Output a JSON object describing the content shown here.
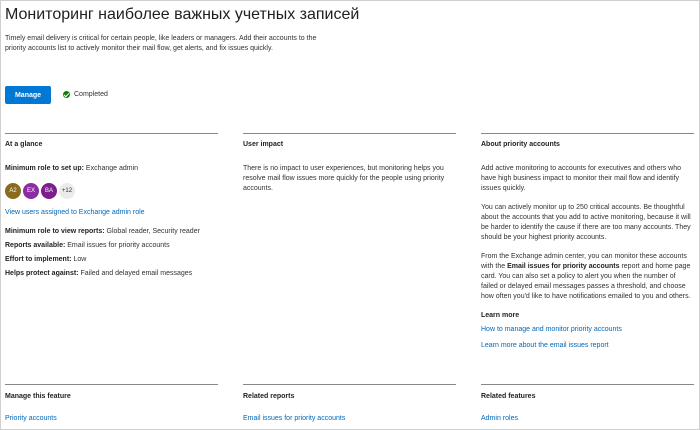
{
  "page": {
    "title": "Мониторинг наиболее важных учетных записей",
    "description": "Timely email delivery is critical for certain people, like leaders or managers. Add their accounts to the priority accounts list to actively monitor their mail flow, get alerts, and fix issues quickly.",
    "manage_label": "Manage",
    "status_label": "Completed",
    "status_color": "#107c10",
    "accent_color": "#0078d4"
  },
  "glance": {
    "heading": "At a glance",
    "min_role_setup_label": "Minimum role to set up:",
    "min_role_setup_value": "Exchange admin",
    "avatars": [
      {
        "initials": "A2",
        "color": "#8a6a1c"
      },
      {
        "initials": "EX",
        "color": "#8a2da5"
      },
      {
        "initials": "BA",
        "color": "#7a1f8c"
      }
    ],
    "avatars_more": "+12",
    "view_users_link": "View users assigned to Exchange admin role",
    "min_role_reports_label": "Minimum role to view reports:",
    "min_role_reports_value": "Global reader, Security reader",
    "reports_label": "Reports available:",
    "reports_value": "Email issues for priority accounts",
    "effort_label": "Effort to implement:",
    "effort_value": "Low",
    "protect_label": "Helps protect against:",
    "protect_value": "Failed and delayed email messages"
  },
  "impact": {
    "heading": "User impact",
    "text": "There is no impact to user experiences, but monitoring helps you resolve mail flow issues more quickly for the people using priority accounts."
  },
  "about": {
    "heading": "About priority accounts",
    "p1": "Add active monitoring to accounts for executives and others who have high business impact to monitor their mail flow and identify issues quickly.",
    "p2": "You can actively monitor up to 250 critical accounts. Be thoughtful about the accounts that you add to active monitoring, because it will be harder to identify the cause if there are too many accounts. They should be your highest priority accounts.",
    "p3_a": "From the Exchange admin center, you can monitor these accounts with the ",
    "p3_bold": "Email issues for priority accounts",
    "p3_b": " report and home page card. You can also set a policy to alert you when the number of failed or delayed email messages passes a threshold, and choose how often you'd like to have notifications emailed to you and others.",
    "learn_more": "Learn more",
    "link1": "How to manage and monitor priority accounts",
    "link2": "Learn more about the email issues report"
  },
  "footer": {
    "manage_heading": "Manage this feature",
    "manage_link": "Priority accounts",
    "reports_heading": "Related reports",
    "reports_link": "Email issues for priority accounts",
    "features_heading": "Related features",
    "features_link": "Admin roles"
  }
}
